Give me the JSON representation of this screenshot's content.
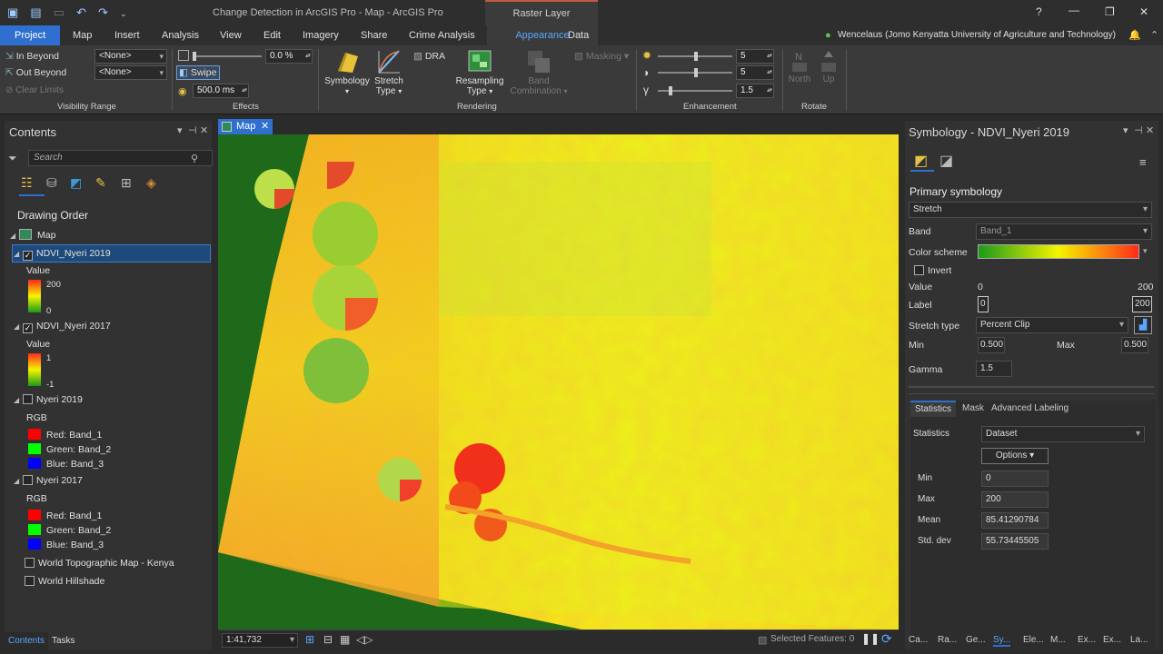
{
  "window": {
    "title": "Change Detection in ArcGIS Pro - Map - ArcGIS Pro",
    "context_tab": "Raster Layer",
    "user": "Wencelaus (Jomo Kenyatta University of Agriculture and Technology)",
    "help": "?",
    "minimize": "—",
    "restore": "❐",
    "close": "✕"
  },
  "ribbon_tabs": [
    "Project",
    "Map",
    "Insert",
    "Analysis",
    "View",
    "Edit",
    "Imagery",
    "Share",
    "Crime Analysis",
    "Appearance",
    "Data"
  ],
  "active_tab": "Appearance",
  "visibility_range": {
    "in_beyond_label": "In Beyond",
    "in_beyond_value": "<None>",
    "out_beyond_label": "Out Beyond",
    "out_beyond_value": "<None>",
    "clear_limits": "Clear Limits",
    "group_label": "Visibility Range"
  },
  "effects": {
    "transparency": "0.0  %",
    "swipe": "Swipe",
    "flicker": "500.0  ms",
    "group_label": "Effects"
  },
  "rendering": {
    "dra": "DRA",
    "symbology": "Symbology",
    "stretch_type": "Stretch Type",
    "resampling_type": "Resampling Type",
    "band_combination": "Band Combination",
    "masking": "Masking",
    "group_label": "Rendering"
  },
  "enhancement": {
    "brightness": "5",
    "contrast": "5",
    "gamma": "1.5",
    "group_label": "Enhancement"
  },
  "rotate": {
    "north": "North",
    "up": "Up",
    "group_label": "Rotate"
  },
  "contents": {
    "title": "Contents",
    "search_placeholder": "Search",
    "drawing_order": "Drawing Order",
    "map": "Map",
    "layers": {
      "ndvi2019": {
        "name": "NDVI_Nyeri 2019",
        "value_label": "Value",
        "max": "200",
        "min": "0"
      },
      "ndvi2017": {
        "name": "NDVI_Nyeri 2017",
        "value_label": "Value",
        "max": "1",
        "min": "-1"
      },
      "nyeri2019": {
        "name": "Nyeri 2019",
        "rgb": "RGB",
        "red": "Red:   Band_1",
        "green": "Green: Band_2",
        "blue": "Blue:  Band_3"
      },
      "nyeri2017": {
        "name": "Nyeri 2017",
        "rgb": "RGB",
        "red": "Red:   Band_1",
        "green": "Green: Band_2",
        "blue": "Blue:  Band_3"
      },
      "topo": {
        "name": "World Topographic Map - Kenya"
      },
      "hillshade": {
        "name": "World Hillshade"
      }
    },
    "bottom_tabs": [
      "Contents",
      "Tasks"
    ]
  },
  "map_view": {
    "tab_label": "Map",
    "scale": "1:41,732",
    "selected_features": "Selected Features: 0"
  },
  "symbology": {
    "title": "Symbology - NDVI_Nyeri 2019",
    "primary": "Primary symbology",
    "renderer": "Stretch",
    "band_label": "Band",
    "band_value": "Band_1",
    "color_scheme_label": "Color scheme",
    "invert": "Invert",
    "value_label": "Value",
    "value_min": "0",
    "value_max": "200",
    "label_label": "Label",
    "label_min": "0",
    "label_max": "200",
    "stretch_type_label": "Stretch type",
    "stretch_type_value": "Percent Clip",
    "min_label": "Min",
    "min_value": "0.500",
    "max_label": "Max",
    "max_value": "0.500",
    "gamma_label": "Gamma",
    "gamma_value": "1.5",
    "tabs": [
      "Statistics",
      "Mask",
      "Advanced Labeling"
    ],
    "statistics_label": "Statistics",
    "statistics_value": "Dataset",
    "options": "Options",
    "stats": [
      {
        "label": "Min",
        "value": "0"
      },
      {
        "label": "Max",
        "value": "200"
      },
      {
        "label": "Mean",
        "value": "85.41290784"
      },
      {
        "label": "Std. dev",
        "value": "55.73445505"
      }
    ],
    "bottom_tabs": [
      "Ca...",
      "Ra...",
      "Ge...",
      "Sy...",
      "Ele...",
      "M...",
      "Ex...",
      "Ex...",
      "La..."
    ]
  },
  "colors": {
    "accent": "#2f6fd0",
    "ramp_green": "#1a9a1a",
    "ramp_yellow": "#f5f500",
    "ramp_red": "#ff2a1a"
  }
}
